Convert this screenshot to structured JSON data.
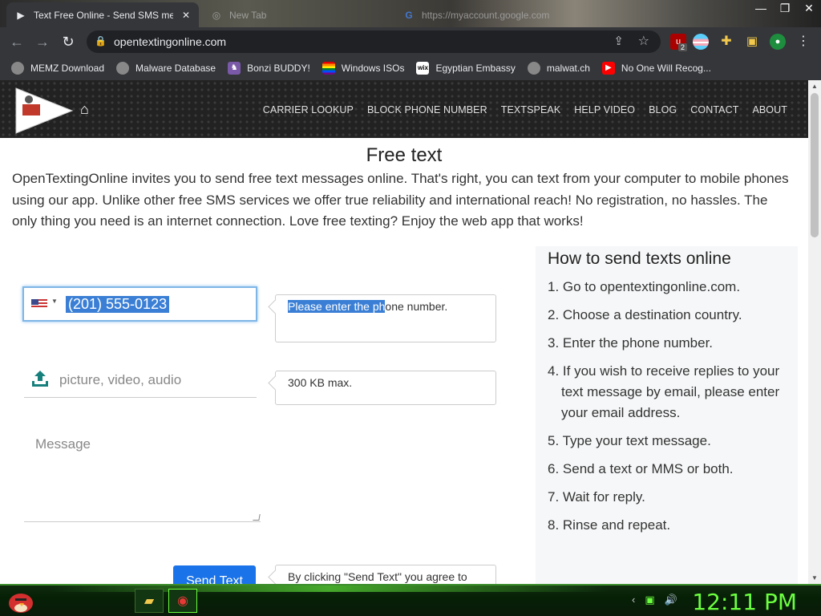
{
  "browser": {
    "tabs": [
      {
        "title": "Text Free Online - Send SMS me",
        "close": "✕",
        "active": true
      },
      {
        "title": "New Tab",
        "close": "",
        "active": false
      },
      {
        "title": "https://myaccount.google.com",
        "close": "",
        "active": false
      }
    ],
    "window_controls": {
      "minimize": "—",
      "restore": "❐",
      "close": "✕"
    },
    "url": "opentextingonline.com",
    "extension_badge": "2",
    "bookmarks": [
      {
        "label": "MEMZ Download",
        "icon": "globe-icon"
      },
      {
        "label": "Malware Database",
        "icon": "globe-icon"
      },
      {
        "label": "Bonzi BUDDY!",
        "icon": "bonzi-icon"
      },
      {
        "label": "Windows ISOs",
        "icon": "rainbow-flag-icon"
      },
      {
        "label": "Egyptian Embassy",
        "icon": "wix-icon"
      },
      {
        "label": "malwat.ch",
        "icon": "globe-icon"
      },
      {
        "label": "No One Will Recog...",
        "icon": "youtube-icon"
      }
    ]
  },
  "site": {
    "nav": [
      "CARRIER LOOKUP",
      "BLOCK PHONE NUMBER",
      "TEXTSPEAK",
      "HELP VIDEO",
      "BLOG",
      "CONTACT",
      "ABOUT"
    ],
    "title": "Free text",
    "intro": "OpenTextingOnline invites you to send free text messages online. That's right, you can text from your computer to mobile phones using our app. Unlike other free SMS services we offer true reliability and international reach! No registration, no hassles. The only thing you need is an internet connection. Love free texting? Enjoy the web app that works!",
    "form": {
      "phone_value": "(201) 555-0123",
      "phone_hint_selected": "Please enter the ph",
      "phone_hint_rest": "one number.",
      "upload_placeholder": "picture, video, audio",
      "upload_hint": "300 KB max.",
      "message_placeholder": "Message",
      "send_label": "Send Text",
      "terms_hint": "By clicking \"Send Text\" you agree to"
    },
    "howto": {
      "title": "How to send texts online",
      "steps": [
        "1. Go to opentextingonline.com.",
        "2. Choose a destination country.",
        "3. Enter the phone number.",
        "4. If you wish to receive replies to your text message by email, please enter your email address.",
        "5. Type your text message.",
        "6. Send a text or MMS or both.",
        "7. Wait for reply.",
        "8. Rinse and repeat."
      ]
    }
  },
  "taskbar": {
    "clock": "12:11 PM"
  }
}
